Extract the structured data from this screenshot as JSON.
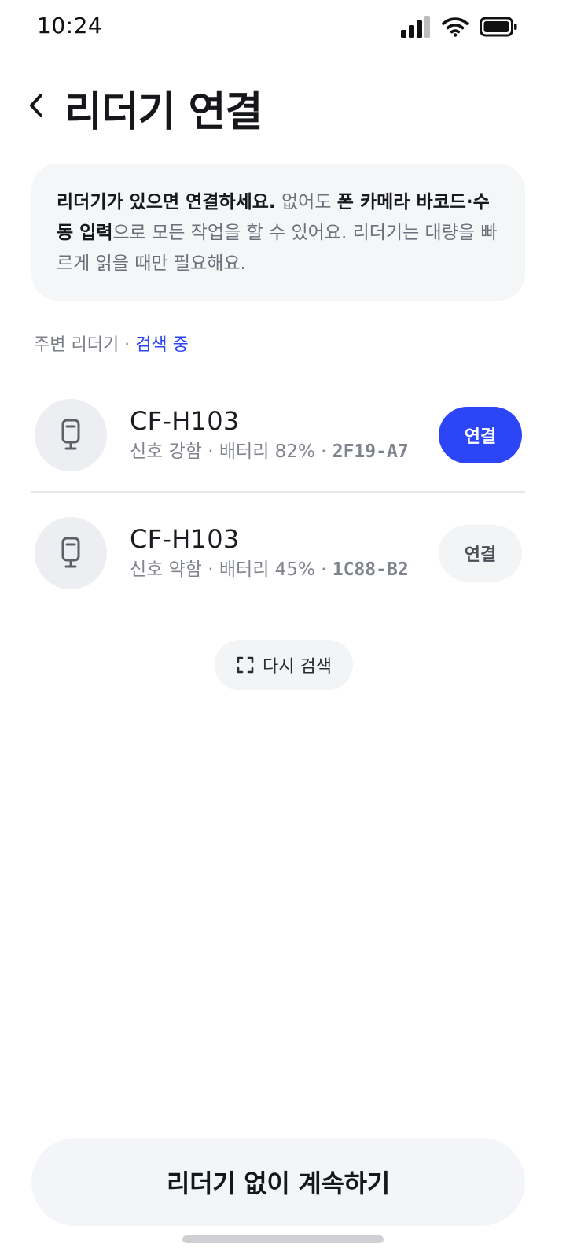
{
  "status_bar": {
    "time": "10:24",
    "icons": [
      "cellular-signal-icon",
      "wifi-icon",
      "battery-icon"
    ]
  },
  "header": {
    "back_icon": "chevron-left-icon",
    "title": "리더기 연결"
  },
  "info_card": {
    "part1_bold": "리더기가 있으면 연결하세요.",
    "part2": " 없어도 ",
    "part3_bold": "폰 카메라 바코드·수동 입력",
    "part4": "으로 모든 작업을 할 수 있어요. 리더기는 대량을 빠르게 읽을 때만 필요해요."
  },
  "section": {
    "label": "주변 리더기 · ",
    "status": "검색 중",
    "status_color": "#2c45f5"
  },
  "devices": [
    {
      "name": "CF-H103",
      "meta_prefix": "신호 강함 · 배터리 82% · ",
      "code": "2F19-A7",
      "connect_label": "연결",
      "icon": "handheld-reader-icon"
    },
    {
      "name": "CF-H103",
      "meta_prefix": "신호 약함 · 배터리 45% · ",
      "code": "1C88-B2",
      "connect_label": "연결",
      "icon": "handheld-reader-icon"
    }
  ],
  "rescan": {
    "label": "다시 검색",
    "icon": "scan-frame-icon"
  },
  "footer": {
    "continue_label": "리더기 없이 계속하기"
  },
  "colors": {
    "accent": "#2b45f7",
    "card_bg": "#f5f6f8",
    "text_primary": "#17181c",
    "text_secondary": "#80848d"
  }
}
